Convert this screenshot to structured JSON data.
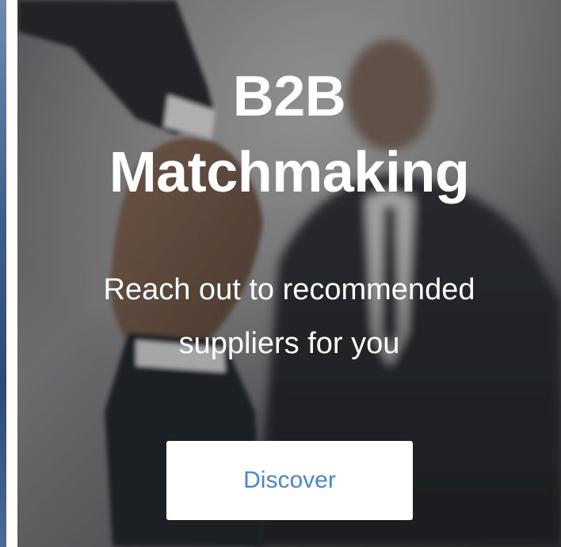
{
  "hero": {
    "title_line1": "B2B",
    "title_line2": "Matchmaking",
    "subtitle_line1": "Reach out to recommended",
    "subtitle_line2": "suppliers for you",
    "cta_label": "Discover",
    "background_image": "business-handshake-photo",
    "cta_text_color": "#4a87c9",
    "text_color": "#ffffff"
  }
}
